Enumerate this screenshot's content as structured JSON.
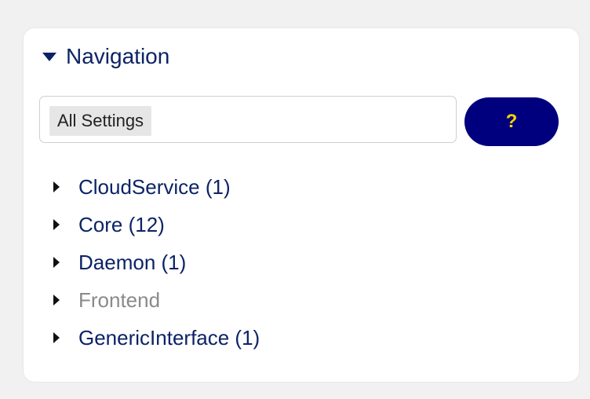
{
  "navigation": {
    "title": "Navigation",
    "selector": {
      "value": "All Settings"
    },
    "help_button": {
      "label": "?"
    },
    "tree": [
      {
        "label": "CloudService (1)",
        "disabled": false
      },
      {
        "label": "Core (12)",
        "disabled": false
      },
      {
        "label": "Daemon (1)",
        "disabled": false
      },
      {
        "label": "Frontend",
        "disabled": true
      },
      {
        "label": "GenericInterface (1)",
        "disabled": false
      }
    ]
  },
  "colors": {
    "page_background": "#f1f1f1",
    "panel_background": "#ffffff",
    "link_text": "#0b2366",
    "disabled_text": "#8a8a8a",
    "help_button_bg": "#00007f",
    "help_button_fg": "#ffd600"
  }
}
